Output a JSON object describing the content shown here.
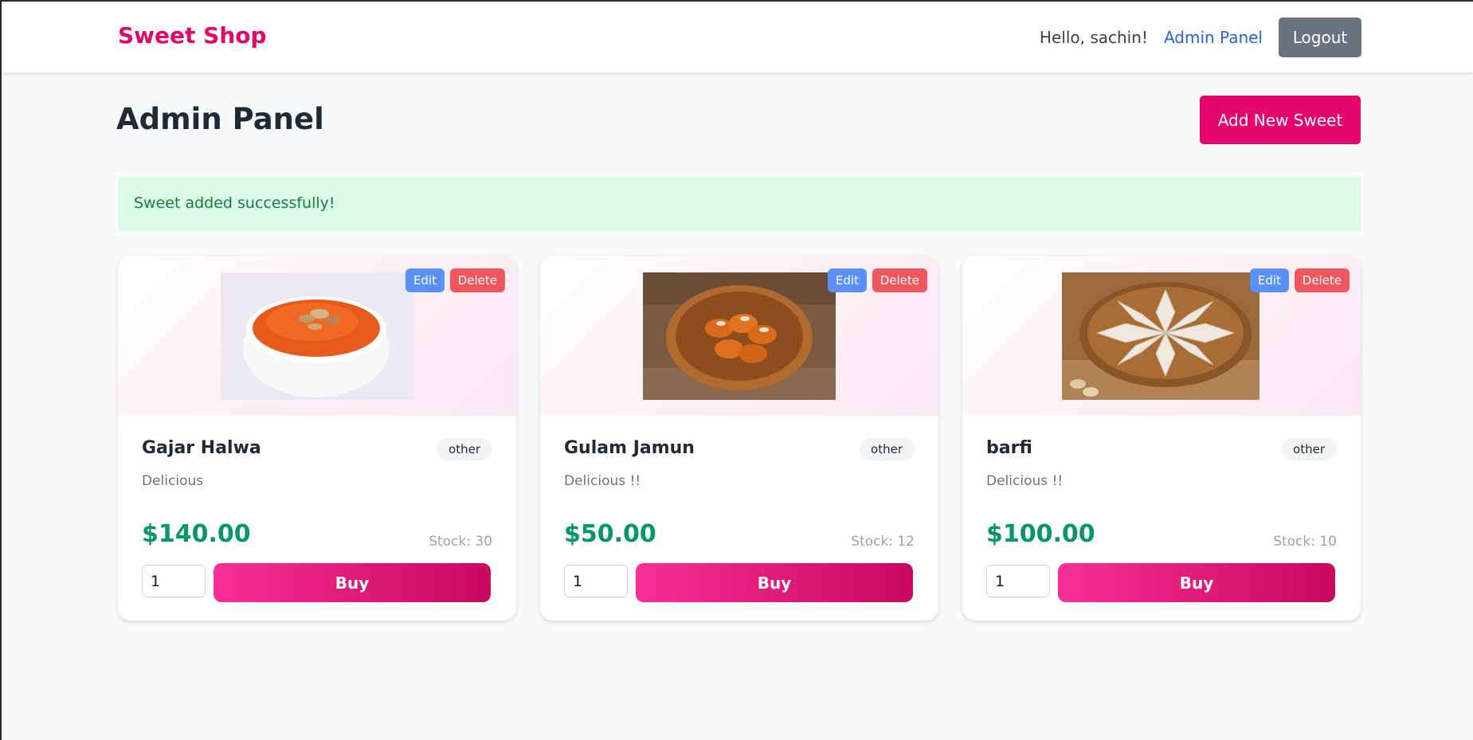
{
  "navbar": {
    "brand": "Sweet Shop",
    "greeting": "Hello, sachin!",
    "admin_link": "Admin Panel",
    "logout_label": "Logout"
  },
  "page": {
    "title": "Admin Panel",
    "add_button": "Add New Sweet",
    "alert": "Sweet added successfully!"
  },
  "colors": {
    "brand": "#e5066d",
    "price": "#059669",
    "edit": "#5b8ff9",
    "delete": "#f0565e",
    "alert_bg": "#dcfce7",
    "alert_text": "#15803d"
  },
  "sweets": [
    {
      "name": "Gajar Halwa",
      "category": "other",
      "description": "Delicious",
      "price": "$140.00",
      "stock": "Stock: 30",
      "quantity": "1",
      "buy_label": "Buy",
      "edit_label": "Edit",
      "delete_label": "Delete",
      "image": "gajar-halwa-bowl-image"
    },
    {
      "name": "Gulam Jamun",
      "category": "other",
      "description": "Delicious !!",
      "price": "$50.00",
      "stock": "Stock: 12",
      "quantity": "1",
      "buy_label": "Buy",
      "edit_label": "Edit",
      "delete_label": "Delete",
      "image": "gulab-jamun-bowl-image"
    },
    {
      "name": "barfi",
      "category": "other",
      "description": "Delicious !!",
      "price": "$100.00",
      "stock": "Stock: 10",
      "quantity": "1",
      "buy_label": "Buy",
      "edit_label": "Edit",
      "delete_label": "Delete",
      "image": "barfi-plate-image"
    }
  ]
}
